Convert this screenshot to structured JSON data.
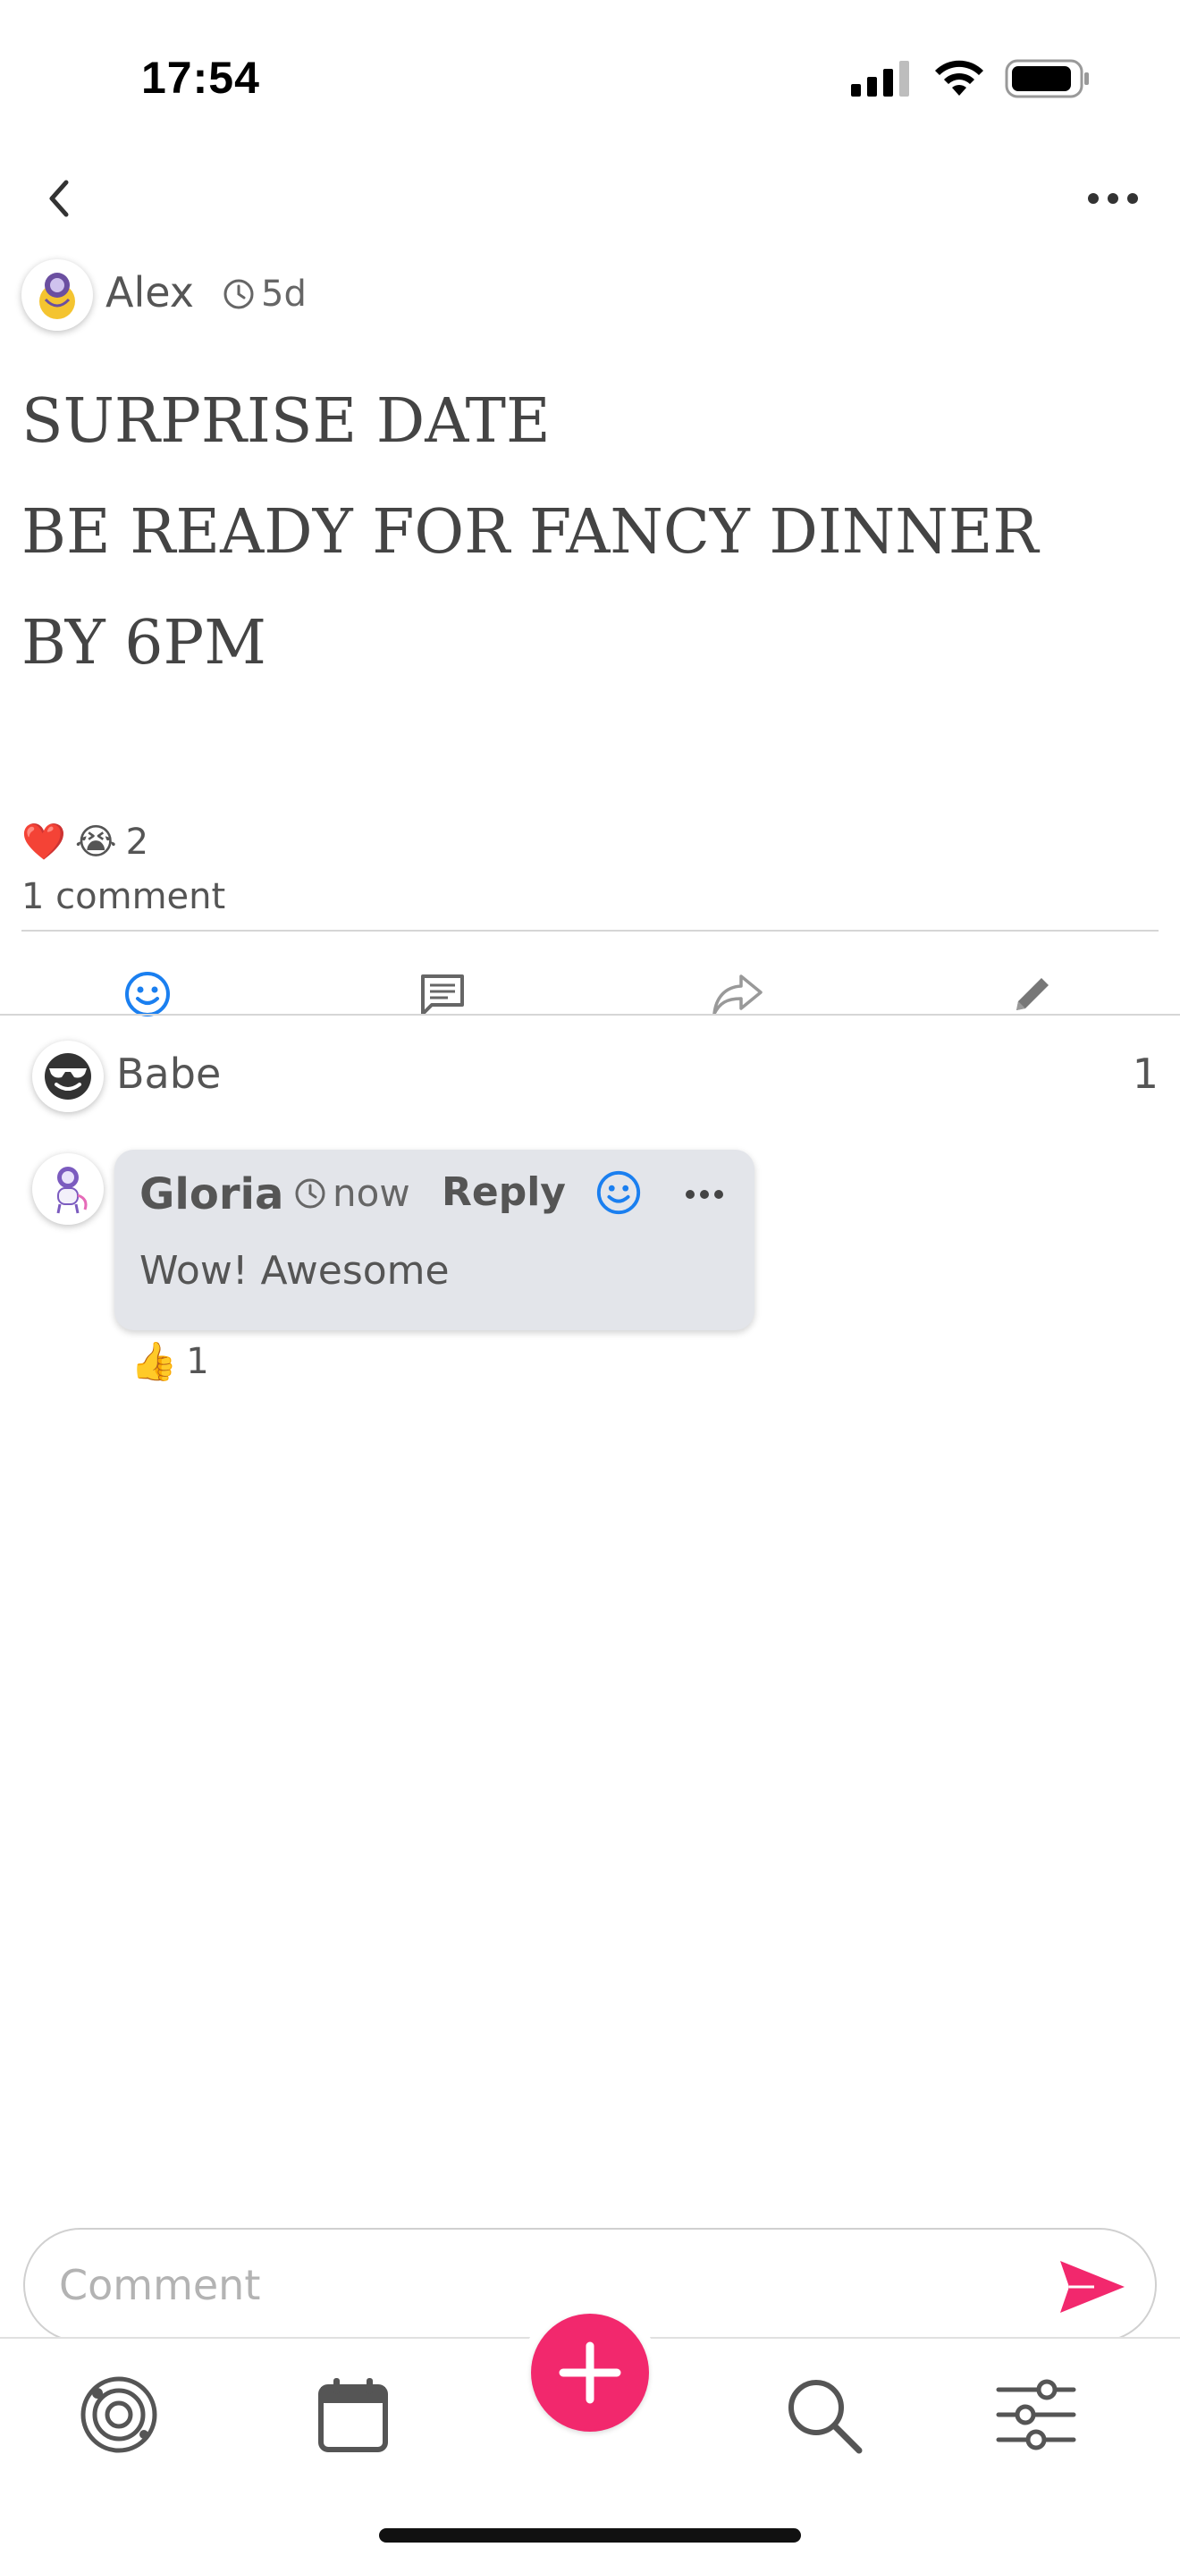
{
  "status_bar": {
    "time": "17:54"
  },
  "author": {
    "name": "Alex",
    "time": "5d"
  },
  "post": {
    "lines": [
      "SURPRISE DATE",
      "BE READY FOR FANCY DINNER",
      "BY 6PM"
    ]
  },
  "reactions": {
    "emojis": [
      "❤️",
      "😭"
    ],
    "count": "2"
  },
  "comments_count": "1 comment",
  "reaction_user": {
    "name": "Babe",
    "count": "1"
  },
  "comment": {
    "author": "Gloria",
    "time": "now",
    "reply_label": "Reply",
    "text": "Wow! Awesome",
    "reaction_emoji": "👍",
    "reaction_count": "1"
  },
  "comment_input": {
    "placeholder": "Comment"
  },
  "colors": {
    "accent": "#f2286d",
    "blue": "#1a7ff0",
    "bubble": "#e3e5ea"
  },
  "icons": {
    "action_bar": [
      "smiley-icon",
      "comment-icon",
      "share-icon",
      "pencil-icon"
    ],
    "bottom_nav": [
      "orbit-icon",
      "calendar-icon",
      "plus-icon",
      "search-icon",
      "sliders-icon"
    ]
  }
}
